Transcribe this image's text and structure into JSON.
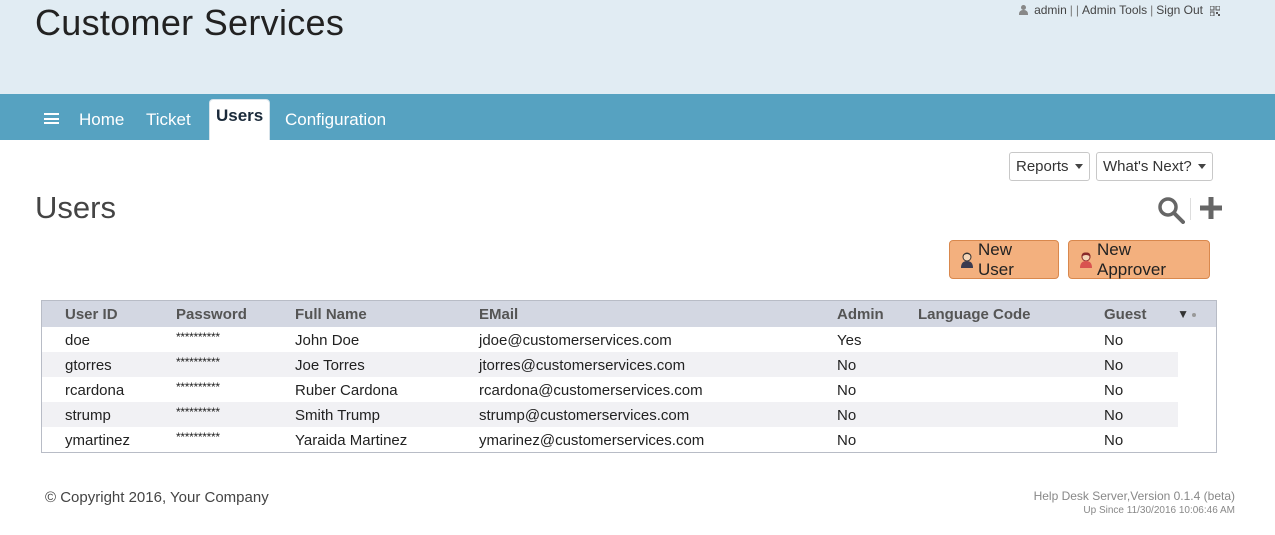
{
  "header": {
    "title": "Customer Services",
    "user_name": "admin",
    "sep1": "|",
    "sep2": "|",
    "admin_tools": "Admin Tools",
    "sep3": "|",
    "sign_out": "Sign Out"
  },
  "nav": {
    "items": [
      {
        "label": "Home"
      },
      {
        "label": "Ticket"
      },
      {
        "label": "Users"
      },
      {
        "label": "Configuration"
      }
    ],
    "active": "Users"
  },
  "toolbar": {
    "reports_label": "Reports",
    "whats_next_label": "What's Next?"
  },
  "page": {
    "title": "Users",
    "new_user_label": "New User",
    "new_approver_label": "New Approver"
  },
  "table": {
    "columns": [
      "User ID",
      "Password",
      "Full Name",
      "EMail",
      "Admin",
      "Language Code",
      "Guest"
    ],
    "rows": [
      {
        "user_id": "doe",
        "password": "**********",
        "full_name": "John Doe",
        "email": "jdoe@customerservices.com",
        "admin": "Yes",
        "language": "",
        "guest": "No"
      },
      {
        "user_id": "gtorres",
        "password": "**********",
        "full_name": "Joe Torres",
        "email": "jtorres@customerservices.com",
        "admin": "No",
        "language": "",
        "guest": "No"
      },
      {
        "user_id": "rcardona",
        "password": "**********",
        "full_name": "Ruber Cardona",
        "email": "rcardona@customerservices.com",
        "admin": "No",
        "language": "",
        "guest": "No"
      },
      {
        "user_id": "strump",
        "password": "**********",
        "full_name": "Smith Trump",
        "email": "strump@customerservices.com",
        "admin": "No",
        "language": "",
        "guest": "No"
      },
      {
        "user_id": "ymartinez",
        "password": "**********",
        "full_name": "Yaraida Martinez",
        "email": "ymarinez@customerservices.com",
        "admin": "No",
        "language": "",
        "guest": "No"
      }
    ]
  },
  "footer": {
    "copyright": "© Copyright 2016, Your Company",
    "version": "Help Desk Server,Version 0.1.4 (beta)",
    "up_since": "Up Since 11/30/2016 10:06:46 AM"
  },
  "colors": {
    "header_bg": "#e1ecf3",
    "nav_bg": "#56a2c1",
    "action_button": "#f3b07e",
    "grid_header": "#d3d7e2"
  },
  "icons": [
    "user-icon",
    "qr-icon",
    "hamburger-icon",
    "caret-down-icon",
    "search-icon",
    "plus-icon",
    "user-male-icon",
    "user-female-icon",
    "column-menu-icon"
  ]
}
